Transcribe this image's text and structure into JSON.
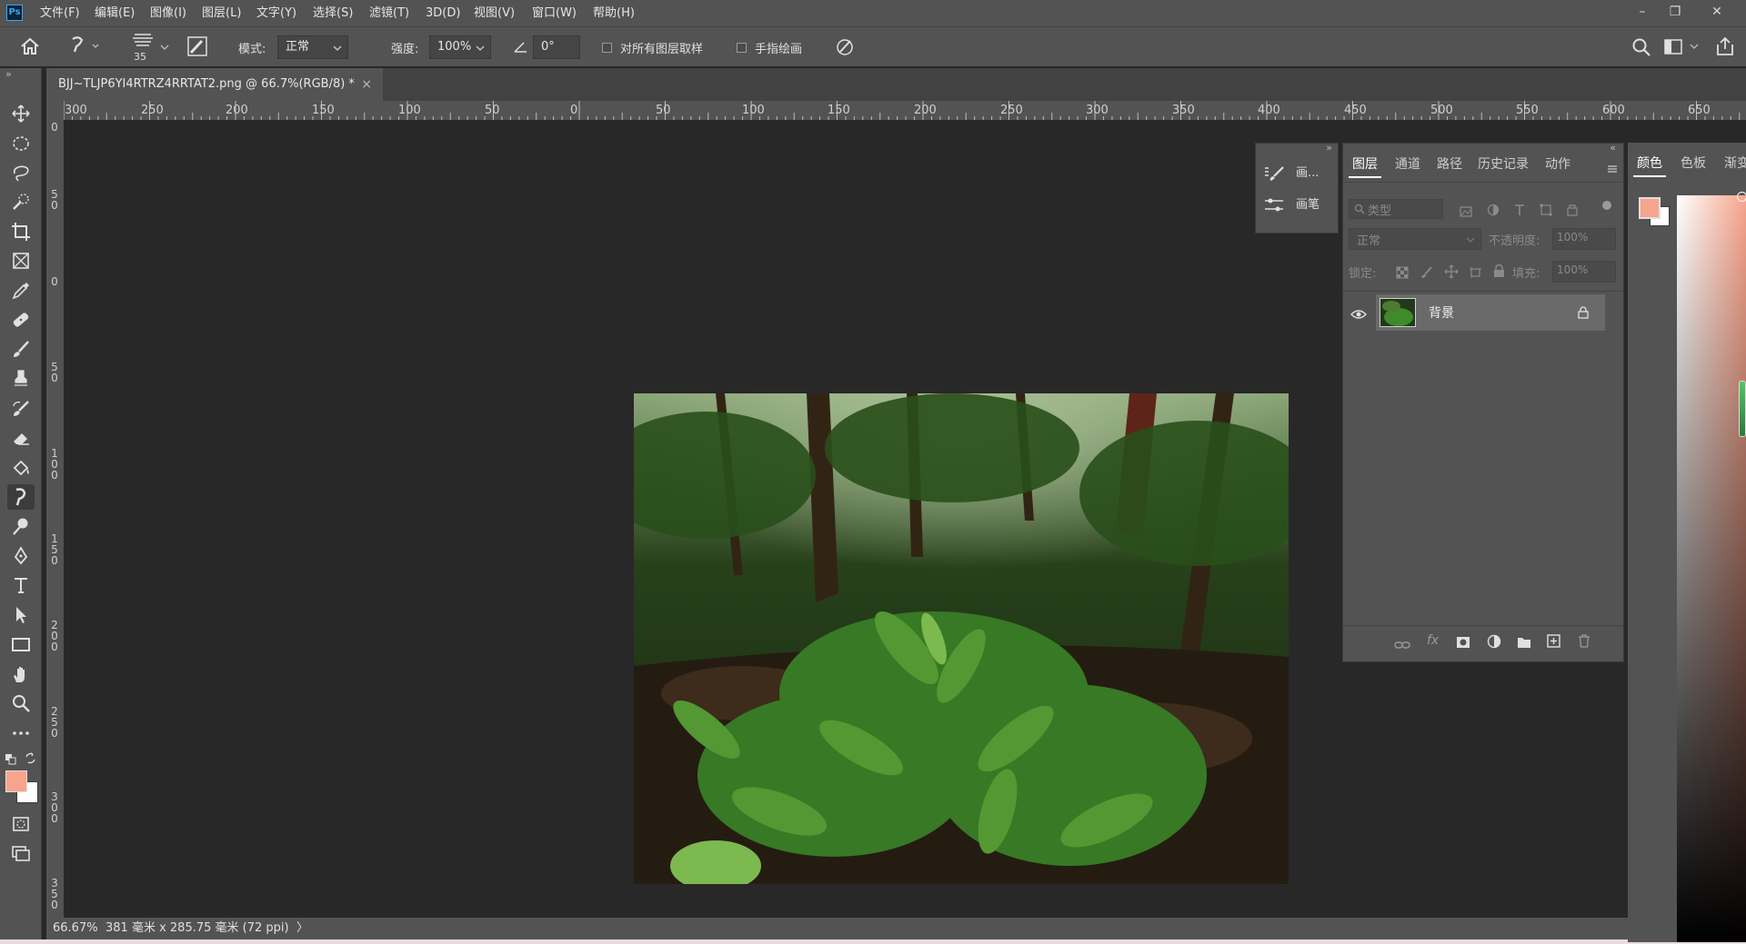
{
  "app": {
    "logo_text": "Ps"
  },
  "menu": {
    "items": [
      "文件(F)",
      "编辑(E)",
      "图像(I)",
      "图层(L)",
      "文字(Y)",
      "选择(S)",
      "滤镜(T)",
      "3D(D)",
      "视图(V)",
      "窗口(W)",
      "帮助(H)"
    ]
  },
  "window_controls": {
    "minimize": "–",
    "restore": "❐",
    "close": "✕"
  },
  "options": {
    "brush_size": "35",
    "mode_label": "模式:",
    "mode_value": "正常",
    "strength_label": "强度:",
    "strength_value": "100%",
    "angle_value": "0°",
    "sample_all_layers_label": "对所有图层取样",
    "sample_all_layers_checked": false,
    "finger_painting_label": "手指绘画",
    "finger_painting_checked": false
  },
  "document_tab": {
    "title": "BJJ~TLJP6YI4RTRZ4RRTAT2.png @ 66.7%(RGB/8) *",
    "close": "×"
  },
  "ruler": {
    "horizontal_labels": [
      "300",
      "250",
      "200",
      "150",
      "100",
      "50",
      "0",
      "50",
      "100",
      "150",
      "200",
      "250",
      "300",
      "350",
      "400",
      "450",
      "500",
      "550",
      "600",
      "650"
    ],
    "vertical_labels": [
      "0",
      "50",
      "0",
      "50",
      "100",
      "150",
      "200",
      "250",
      "300",
      "350"
    ]
  },
  "status_bar": {
    "zoom": "66.67%",
    "doc_info": "381 毫米 x 285.75 毫米 (72 ppi)",
    "arrow": "〉"
  },
  "mini_panel": {
    "collapse": "»",
    "items": [
      "画...",
      "画笔"
    ]
  },
  "layers_panel": {
    "collapse": "«",
    "tabs": [
      "图层",
      "通道",
      "路径",
      "历史记录",
      "动作"
    ],
    "active_tab": "图层",
    "filter_placeholder": "类型",
    "blend_mode": "正常",
    "opacity_label": "不透明度:",
    "opacity_value": "100%",
    "lock_label": "锁定:",
    "fill_label": "填充:",
    "fill_value": "100%",
    "layers": [
      {
        "name": "背景",
        "visible": true,
        "locked": true
      }
    ]
  },
  "color_panel": {
    "tabs": [
      "颜色",
      "色板",
      "渐变"
    ],
    "foreground_color": "#f7a48c",
    "background_color": "#ffffff"
  },
  "colors": {
    "accent": "#31a8ff",
    "foreground_swatch": "#f7a48c"
  }
}
